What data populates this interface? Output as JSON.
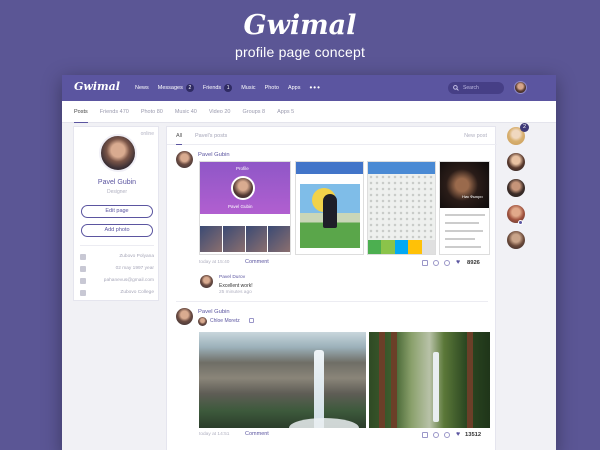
{
  "hero": {
    "title": "Gwimal",
    "subtitle": "profile page concept"
  },
  "topbar": {
    "logo": "Gwimal",
    "nav": [
      {
        "label": "News",
        "badge": ""
      },
      {
        "label": "Messages",
        "badge": "2"
      },
      {
        "label": "Friends",
        "badge": "1"
      },
      {
        "label": "Music",
        "badge": ""
      },
      {
        "label": "Photo",
        "badge": ""
      },
      {
        "label": "Apps",
        "badge": ""
      }
    ],
    "more": "•••",
    "search_placeholder": "Search"
  },
  "subnav": {
    "tabs": [
      {
        "label": "Posts",
        "active": true
      },
      {
        "label": "Friends 470",
        "active": false
      },
      {
        "label": "Photo 80",
        "active": false
      },
      {
        "label": "Music 40",
        "active": false
      },
      {
        "label": "Video 20",
        "active": false
      },
      {
        "label": "Groups 8",
        "active": false
      },
      {
        "label": "Apps 5",
        "active": false
      }
    ]
  },
  "profile": {
    "status": "online",
    "name": "Pavel Gubin",
    "role": "Designer",
    "edit_label": "Edit page",
    "add_photo_label": "Add photo",
    "info": [
      {
        "icon": "building-icon",
        "text": "Zubovo Polyana"
      },
      {
        "icon": "calendar-icon",
        "text": "02 may 1997 year"
      },
      {
        "icon": "mail-icon",
        "text": "pahanevus@gmail.com"
      },
      {
        "icon": "graduation-icon",
        "text": "Zubovo College"
      }
    ]
  },
  "feed": {
    "tabs": [
      "All",
      "Pavel's posts"
    ],
    "new_post": "New post",
    "post1": {
      "author": "Pavel Gubin",
      "time": "today at 15:40",
      "comment_label": "Comment",
      "likes": "8926",
      "screen_texts": {
        "profile_title": "Profile",
        "profile_name": "Pavel Gubin",
        "poster_title": "Ник Фьюри"
      },
      "comment": {
        "author": "Pavel Durov",
        "text": "Excellent work!",
        "time": "25 minutes ago"
      }
    },
    "post2": {
      "author": "Pavel Gubin",
      "tag": "Chloe Moretz",
      "time": "today at 14:51",
      "comment_label": "Comment",
      "likes": "13512"
    }
  },
  "rail": {
    "badge": "2"
  },
  "colors": {
    "accent": "#5b55a0",
    "background": "#5b5695",
    "topbar": "#5b55a0"
  }
}
